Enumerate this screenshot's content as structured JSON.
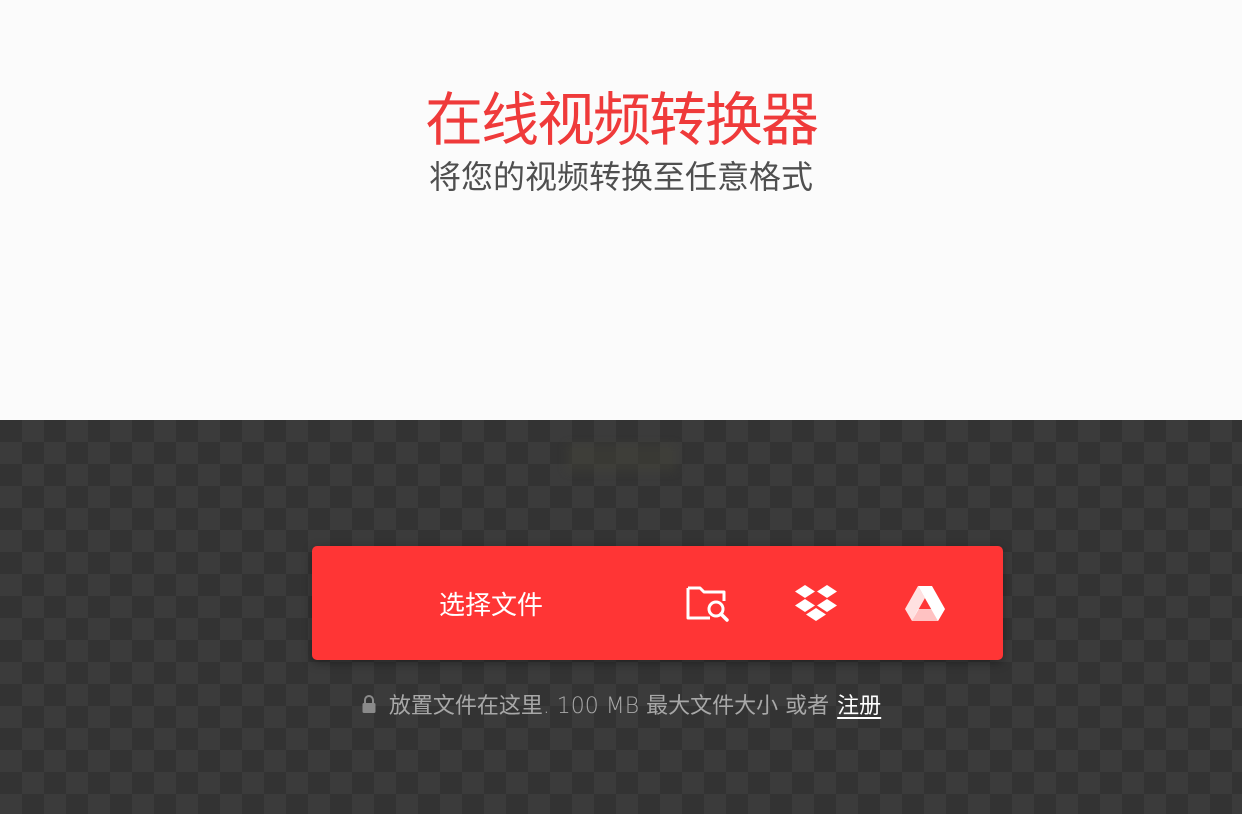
{
  "hero": {
    "title": "在线视频转换器",
    "subtitle": "将您的视频转换至任意格式"
  },
  "uploader": {
    "choose_file_label": "选择文件",
    "sources": [
      {
        "name": "device",
        "icon": "folder-search-icon"
      },
      {
        "name": "dropbox",
        "icon": "dropbox-icon"
      },
      {
        "name": "google-drive",
        "icon": "google-drive-icon"
      }
    ],
    "hint": "放置文件在这里. 100 MB 最大文件大小 或者",
    "signup_label": "注册"
  },
  "colors": {
    "accent": "#ff3535",
    "title": "#ef3a3a",
    "dark_bg": "#333333",
    "hero_bg": "#fbfbfb"
  }
}
